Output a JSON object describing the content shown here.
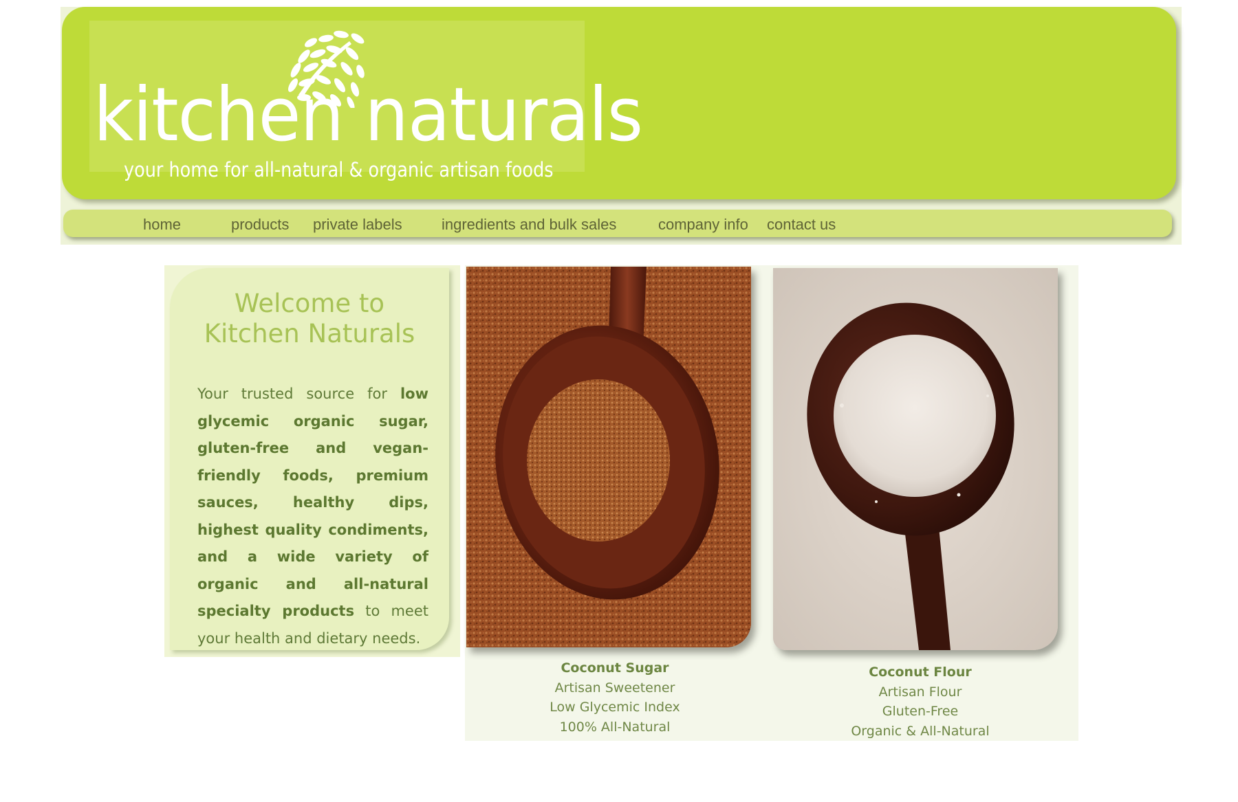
{
  "header": {
    "brand": "kitchen naturals",
    "tagline": "your home for all-natural & organic artisan foods",
    "logo_icon": "leaf-logo-icon"
  },
  "nav": {
    "items": [
      {
        "label": "home"
      },
      {
        "label": "products"
      },
      {
        "label": "private labels"
      },
      {
        "label": "ingredients and bulk sales"
      },
      {
        "label": "company info"
      },
      {
        "label": "contact us"
      }
    ]
  },
  "welcome": {
    "title_line1": "Welcome to",
    "title_line2": "Kitchen Naturals",
    "intro": "Your trusted source for",
    "highlight": "low glycemic organic sugar, gluten-free and vegan-friendly foods, premium sauces, healthy dips, highest quality condiments, and a wide variety of organic and all-natural specialty products",
    "outro": "to meet your health and dietary needs."
  },
  "products": [
    {
      "name": "Coconut Sugar",
      "line1": "Artisan Sweetener",
      "line2": "Low Glycemic Index",
      "line3": "100% All-Natural"
    },
    {
      "name": "Coconut Flour",
      "line1": "Artisan Flour",
      "line2": "Gluten-Free",
      "line3": "Organic & All-Natural"
    }
  ],
  "colors": {
    "banner_green": "#bedb38",
    "nav_green": "#d3e27b",
    "panel_green": "#e8f1c0",
    "text_green": "#5f7a37"
  }
}
